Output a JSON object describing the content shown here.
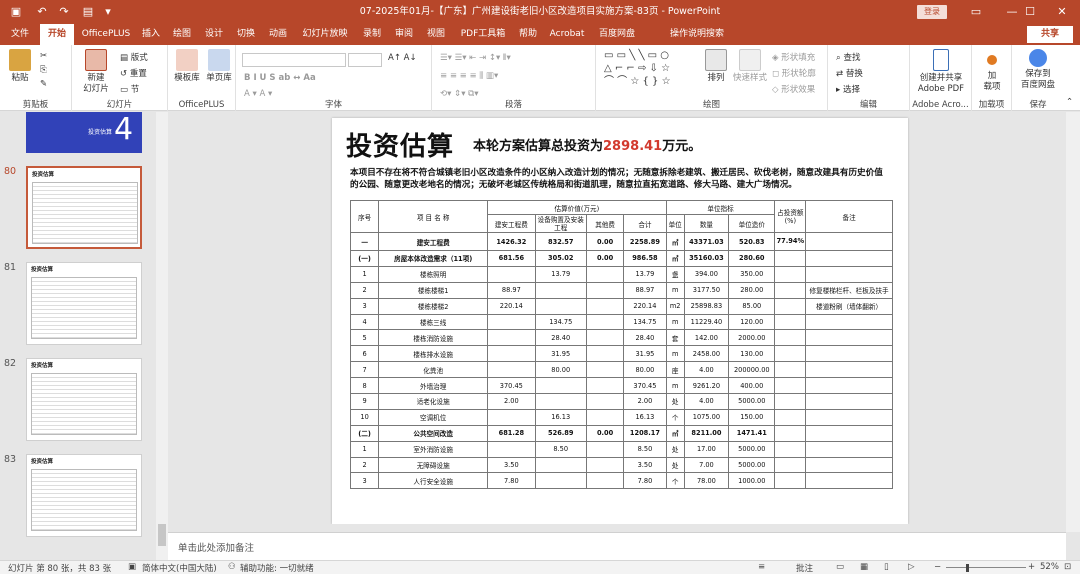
{
  "window": {
    "title": "07-2025年01月-【广东】广州建设街老旧小区改造项目实施方案-83页  -  PowerPoint",
    "login": "登录",
    "share": "共享"
  },
  "tabs": [
    "文件",
    "开始",
    "OfficePLUS",
    "插入",
    "绘图",
    "设计",
    "切换",
    "动画",
    "幻灯片放映",
    "录制",
    "审阅",
    "视图",
    "PDF工具箱",
    "帮助",
    "Acrobat",
    "百度网盘",
    "操作说明搜索"
  ],
  "ribbon": {
    "clipboard": {
      "paste": "粘贴",
      "label": "剪贴板"
    },
    "slides": {
      "new_slide": "新建\n幻灯片",
      "layout": "版式",
      "reset": "重置",
      "section": "节",
      "label": "幻灯片"
    },
    "officeplus": {
      "templates": "模板库",
      "images": "单页库",
      "label": "OfficePLUS"
    },
    "font": {
      "label": "字体"
    },
    "paragraph": {
      "label": "段落"
    },
    "drawing": {
      "arrange": "排列",
      "quick_styles": "快速样式",
      "fill": "形状填充",
      "outline": "形状轮廓",
      "effects": "形状效果",
      "label": "绘图"
    },
    "editing": {
      "find": "查找",
      "replace": "替换",
      "select": "选择",
      "label": "编辑"
    },
    "adobe": {
      "create": "创建并共享\nAdobe PDF",
      "label": "Adobe Acro..."
    },
    "addins": {
      "addins": "加\n载项",
      "label": "加载项"
    },
    "save": {
      "save_to": "保存到\n百度网盘",
      "label": "保存"
    }
  },
  "thumbnails": [
    {
      "num": "",
      "caption": "投资估算",
      "big": "4"
    },
    {
      "num": "80",
      "caption": "投资估算"
    },
    {
      "num": "81",
      "caption": "投资估算"
    },
    {
      "num": "82",
      "caption": "投资估算"
    },
    {
      "num": "83",
      "caption": "投资估算"
    }
  ],
  "slide": {
    "title": "投资估算",
    "subtitle_pre": "本轮方案估算总投资为",
    "subtitle_amount": "2898.41",
    "subtitle_post": "万元。",
    "body": "本项目不存在将不符合城镇老旧小区改造条件的小区纳入改造计划的情况；无随意拆除老建筑、搬迁居民、砍伐老树，随意改建具有历史价值的公园、随意更改老地名的情况；无破坏老城区传统格局和街道肌理，随意拉直拓宽道路、修大马路、建大广场情况。",
    "table": {
      "h_seq": "序号",
      "h_name": "项 目 名 称",
      "h_value": "估算价值(万元)",
      "h_unit_index": "单位指标",
      "h_ratio": "占投资额(%)",
      "h_remark": "备注",
      "h_build": "建安工程费",
      "h_equip": "设备购置及安装工程",
      "h_other": "其他费",
      "h_total": "合计",
      "h_unit": "单位",
      "h_qty": "数量",
      "h_price": "单位造价",
      "rows": [
        {
          "b": true,
          "seq": "一",
          "name": "建安工程费",
          "build": "1426.32",
          "equip": "832.57",
          "other": "0.00",
          "total": "2258.89",
          "unit": "㎡",
          "qty": "43371.03",
          "price": "520.83",
          "ratio": "77.94%",
          "remark": ""
        },
        {
          "b": true,
          "seq": "(一)",
          "name": "房屋本体改造需求（11项)",
          "build": "681.56",
          "equip": "305.02",
          "other": "0.00",
          "total": "986.58",
          "unit": "㎡",
          "qty": "35160.03",
          "price": "280.60",
          "ratio": "",
          "remark": ""
        },
        {
          "b": false,
          "seq": "1",
          "name": "楼栋照明",
          "build": "",
          "equip": "13.79",
          "other": "",
          "total": "13.79",
          "unit": "盏",
          "qty": "394.00",
          "price": "350.00",
          "ratio": "",
          "remark": ""
        },
        {
          "b": false,
          "seq": "2",
          "name": "楼栋楼梯1",
          "build": "88.97",
          "equip": "",
          "other": "",
          "total": "88.97",
          "unit": "m",
          "qty": "3177.50",
          "price": "280.00",
          "ratio": "",
          "remark": "修复楼梯栏杆、栏板及扶手"
        },
        {
          "b": false,
          "seq": "3",
          "name": "楼栋楼梯2",
          "build": "220.14",
          "equip": "",
          "other": "",
          "total": "220.14",
          "unit": "m2",
          "qty": "25898.83",
          "price": "85.00",
          "ratio": "",
          "remark": "楼道粉刷（墙体翻新）"
        },
        {
          "b": false,
          "seq": "4",
          "name": "楼栋三线",
          "build": "",
          "equip": "134.75",
          "other": "",
          "total": "134.75",
          "unit": "m",
          "qty": "11229.40",
          "price": "120.00",
          "ratio": "",
          "remark": ""
        },
        {
          "b": false,
          "seq": "5",
          "name": "楼栋消防设施",
          "build": "",
          "equip": "28.40",
          "other": "",
          "total": "28.40",
          "unit": "套",
          "qty": "142.00",
          "price": "2000.00",
          "ratio": "",
          "remark": ""
        },
        {
          "b": false,
          "seq": "6",
          "name": "楼栋排水设施",
          "build": "",
          "equip": "31.95",
          "other": "",
          "total": "31.95",
          "unit": "m",
          "qty": "2458.00",
          "price": "130.00",
          "ratio": "",
          "remark": ""
        },
        {
          "b": false,
          "seq": "7",
          "name": "化粪池",
          "build": "",
          "equip": "80.00",
          "other": "",
          "total": "80.00",
          "unit": "座",
          "qty": "4.00",
          "price": "200000.00",
          "ratio": "",
          "remark": ""
        },
        {
          "b": false,
          "seq": "8",
          "name": "外墙治理",
          "build": "370.45",
          "equip": "",
          "other": "",
          "total": "370.45",
          "unit": "m",
          "qty": "9261.20",
          "price": "400.00",
          "ratio": "",
          "remark": ""
        },
        {
          "b": false,
          "seq": "9",
          "name": "适老化设施",
          "build": "2.00",
          "equip": "",
          "other": "",
          "total": "2.00",
          "unit": "处",
          "qty": "4.00",
          "price": "5000.00",
          "ratio": "",
          "remark": ""
        },
        {
          "b": false,
          "seq": "10",
          "name": "空调机位",
          "build": "",
          "equip": "16.13",
          "other": "",
          "total": "16.13",
          "unit": "个",
          "qty": "1075.00",
          "price": "150.00",
          "ratio": "",
          "remark": ""
        },
        {
          "b": true,
          "seq": "(二)",
          "name": "公共空间改造",
          "build": "681.28",
          "equip": "526.89",
          "other": "0.00",
          "total": "1208.17",
          "unit": "㎡",
          "qty": "8211.00",
          "price": "1471.41",
          "ratio": "",
          "remark": ""
        },
        {
          "b": false,
          "seq": "1",
          "name": "室外消防设施",
          "build": "",
          "equip": "8.50",
          "other": "",
          "total": "8.50",
          "unit": "处",
          "qty": "17.00",
          "price": "5000.00",
          "ratio": "",
          "remark": ""
        },
        {
          "b": false,
          "seq": "2",
          "name": "无障碍设施",
          "build": "3.50",
          "equip": "",
          "other": "",
          "total": "3.50",
          "unit": "处",
          "qty": "7.00",
          "price": "5000.00",
          "ratio": "",
          "remark": ""
        },
        {
          "b": false,
          "seq": "3",
          "name": "人行安全设施",
          "build": "7.80",
          "equip": "",
          "other": "",
          "total": "7.80",
          "unit": "个",
          "qty": "78.00",
          "price": "1000.00",
          "ratio": "",
          "remark": ""
        }
      ]
    }
  },
  "notes_placeholder": "单击此处添加备注",
  "status": {
    "slide_info": "幻灯片 第 80 张，共 83 张",
    "language": "简体中文(中国大陆)",
    "accessibility": "辅助功能: 一切就绪",
    "notes": "批注",
    "zoom": "52%"
  },
  "colors": {
    "accent": "#b7472a",
    "highlight": "#d23a2e"
  }
}
